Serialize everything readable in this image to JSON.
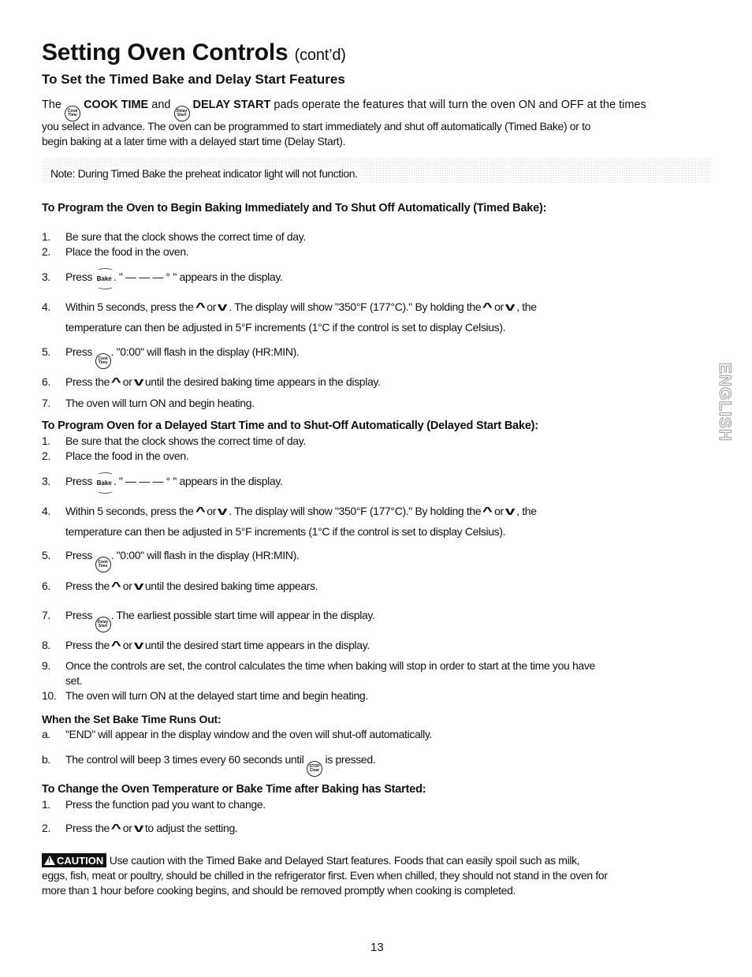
{
  "header": {
    "title": "Setting Oven Controls",
    "title_suffix": "(cont’d)",
    "subtitle": "To Set the Timed Bake and Delay Start Features"
  },
  "pads": {
    "cook_time": {
      "line1": "Cook",
      "line2": "Time"
    },
    "delay_start": {
      "line1": "Delay",
      "line2": "Start"
    },
    "stop_clear": {
      "line1": "STOP",
      "line2": "Clear"
    },
    "bake": "Bake"
  },
  "intro": {
    "the": "The",
    "cook_time_label": "COOK TIME",
    "and": "and",
    "delay_start_label": "DELAY START",
    "line1_rest": "pads operate the features that will turn the oven ON and OFF at the times",
    "line2": "you select in advance. The oven can be programmed to start immediately and shut off automatically (Timed Bake) or to",
    "line3": "begin baking at a later time with a delayed start time (Delay Start)."
  },
  "note": "Note: During Timed Bake the preheat indicator light will not function.",
  "timed_bake": {
    "heading": "To Program the Oven to Begin Baking Immediately and To Shut Off Automatically (Timed Bake):",
    "steps": [
      {
        "num": "1.",
        "text": "Be sure that the clock shows the correct time of day."
      },
      {
        "num": "2.",
        "text": "Place the food in the oven."
      },
      {
        "num": "3.",
        "pre": "Press",
        "post": "\" — — — ° \" appears in the display."
      },
      {
        "num": "4.",
        "pre": "Within 5 seconds, press the",
        "or": "or",
        "mid": ". The display will show \"350°F (177°C).\" By holding the",
        "post": ", the",
        "line2": "temperature can then be adjusted in 5°F increments (1°C if the control is set to display Celsius)."
      },
      {
        "num": "5.",
        "pre": "Press",
        "post": ". \"0:00\" will flash in the display (HR:MIN)."
      },
      {
        "num": "6.",
        "pre": "Press the",
        "or": "or",
        "post": "until the desired baking time appears in the display."
      },
      {
        "num": "7.",
        "text": "The oven will turn ON and begin heating."
      }
    ]
  },
  "delayed_bake": {
    "heading": "To Program Oven for a Delayed Start Time and to Shut-Off Automatically (Delayed Start Bake):",
    "steps": [
      {
        "num": "1.",
        "text": "Be sure that the clock shows the correct time of day."
      },
      {
        "num": "2.",
        "text": "Place the food in the oven."
      },
      {
        "num": "3.",
        "pre": "Press",
        "post": "\" — — — ° \" appears in the display."
      },
      {
        "num": "4.",
        "pre": "Within 5 seconds, press the",
        "or": "or",
        "mid": ". The display will show \"350°F (177°C).\" By holding the",
        "post": ", the",
        "line2": "temperature can then be adjusted in 5°F increments (1°C if the control is set to display Celsius)."
      },
      {
        "num": "5.",
        "pre": "Press",
        "post": ". \"0:00\" will flash in the display (HR:MIN)."
      },
      {
        "num": "6.",
        "pre": "Press the",
        "or": "or",
        "post": "until the desired baking time appears."
      },
      {
        "num": "7.",
        "pre": "Press",
        "post": ". The earliest possible start time will appear in the display."
      },
      {
        "num": "8.",
        "pre": "Press the",
        "or": "or",
        "post": "until the desired start time appears in the display."
      },
      {
        "num": "9.",
        "text": "Once the controls are set, the control calculates the time when baking will stop in order to start at the time you have",
        "line2": "set."
      },
      {
        "num": "10.",
        "text": "The oven will turn ON at the delayed start time and begin heating."
      }
    ]
  },
  "runs_out": {
    "heading": "When the Set Bake Time Runs Out:",
    "items": [
      {
        "num": "a.",
        "text": "\"END\" will appear in the display window and the oven will shut-off automatically."
      },
      {
        "num": "b.",
        "pre": "The control will beep 3 times every 60 seconds until",
        "post": "is pressed."
      }
    ]
  },
  "change": {
    "heading": "To Change the Oven Temperature or Bake Time after Baking has Started:",
    "steps": [
      {
        "num": "1.",
        "text": "Press the function pad you want to change."
      },
      {
        "num": "2.",
        "pre": "Press the",
        "or": "or",
        "post": "to adjust the setting."
      }
    ]
  },
  "caution": {
    "badge": "CAUTION",
    "line1": "Use caution with the Timed Bake and Delayed Start features. Foods that can easily spoil such as milk,",
    "line2": "eggs, fish, meat or poultry, should be chilled in the refrigerator first. Even when chilled, they should not stand in the oven for",
    "line3": "more than 1 hour before cooking begins, and should be removed promptly when cooking is completed."
  },
  "side_tab": "ENGLISH",
  "page_number": "13"
}
